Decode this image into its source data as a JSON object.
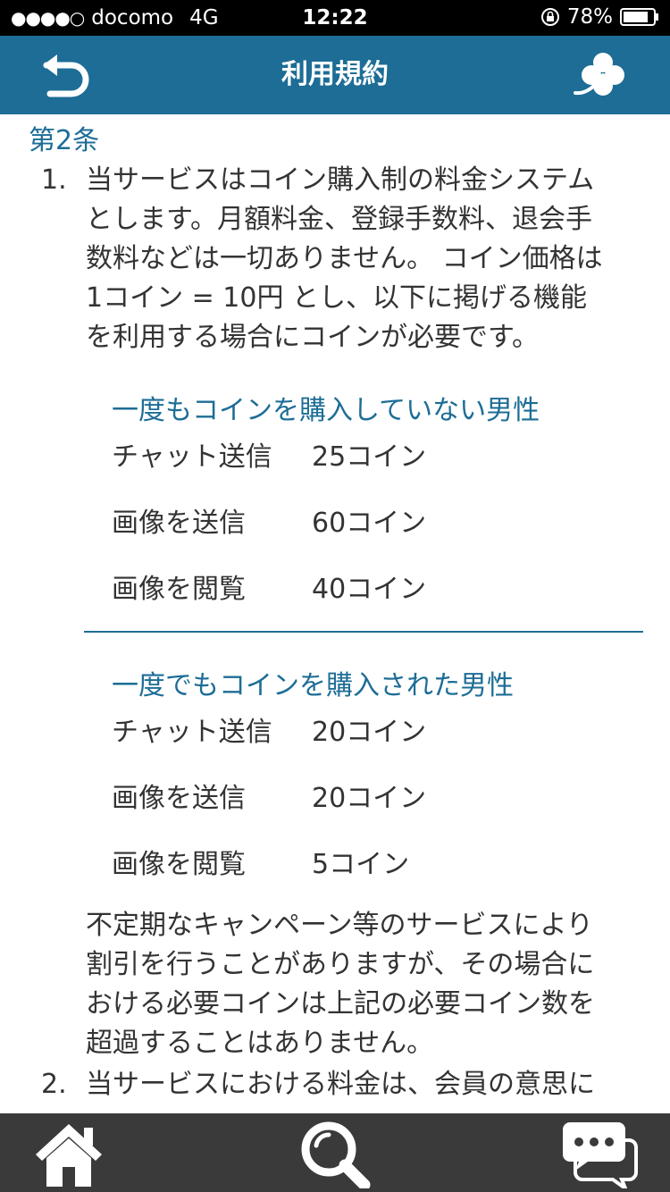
{
  "status_bar": {
    "signal": "●●●●○",
    "carrier": "docomo",
    "network": "4G",
    "time": "12:22",
    "battery": "78%"
  },
  "nav": {
    "title": "利用規約",
    "back_icon": "back-arrow-icon",
    "right_icon": "clover-icon"
  },
  "article": {
    "heading": "第2条",
    "item1": {
      "number": "1.",
      "intro_lines": [
        "当サービスはコイン購入制の料金システム",
        "とします。月額料金、登録手数料、退会手",
        "数料などは一切ありません。 コイン価格は",
        "1コイン = 10円 とし、以下に掲げる機能",
        "を利用する場合にコインが必要です。"
      ],
      "section_new": {
        "heading": "一度もコインを購入していない男性",
        "rows": [
          {
            "label": "チャット送信",
            "value": "25コイン"
          },
          {
            "label": "画像を送信",
            "value": "60コイン"
          },
          {
            "label": "画像を閲覧",
            "value": "40コイン"
          }
        ]
      },
      "section_paid": {
        "heading": "一度でもコインを購入された男性",
        "rows": [
          {
            "label": "チャット送信",
            "value": "20コイン"
          },
          {
            "label": "画像を送信",
            "value": "20コイン"
          },
          {
            "label": "画像を閲覧",
            "value": "5コイン"
          }
        ]
      },
      "outro_lines": [
        "不定期なキャンペーン等のサービスにより",
        "割引を行うことがありますが、その場合に",
        "おける必要コインは上記の必要コイン数を",
        "超過することはありません。"
      ]
    },
    "item2": {
      "number": "2.",
      "first_line": "当サービスにおける料金は、会員の意思に"
    }
  },
  "tab_bar": {
    "items": [
      {
        "name": "home",
        "icon": "home-icon"
      },
      {
        "name": "search",
        "icon": "search-icon"
      },
      {
        "name": "chat",
        "icon": "chat-icon"
      }
    ]
  },
  "colors": {
    "accent": "#1d6d96",
    "text": "#333333",
    "tab_bar": "#3a3a3a",
    "status_bar": "#000000"
  }
}
